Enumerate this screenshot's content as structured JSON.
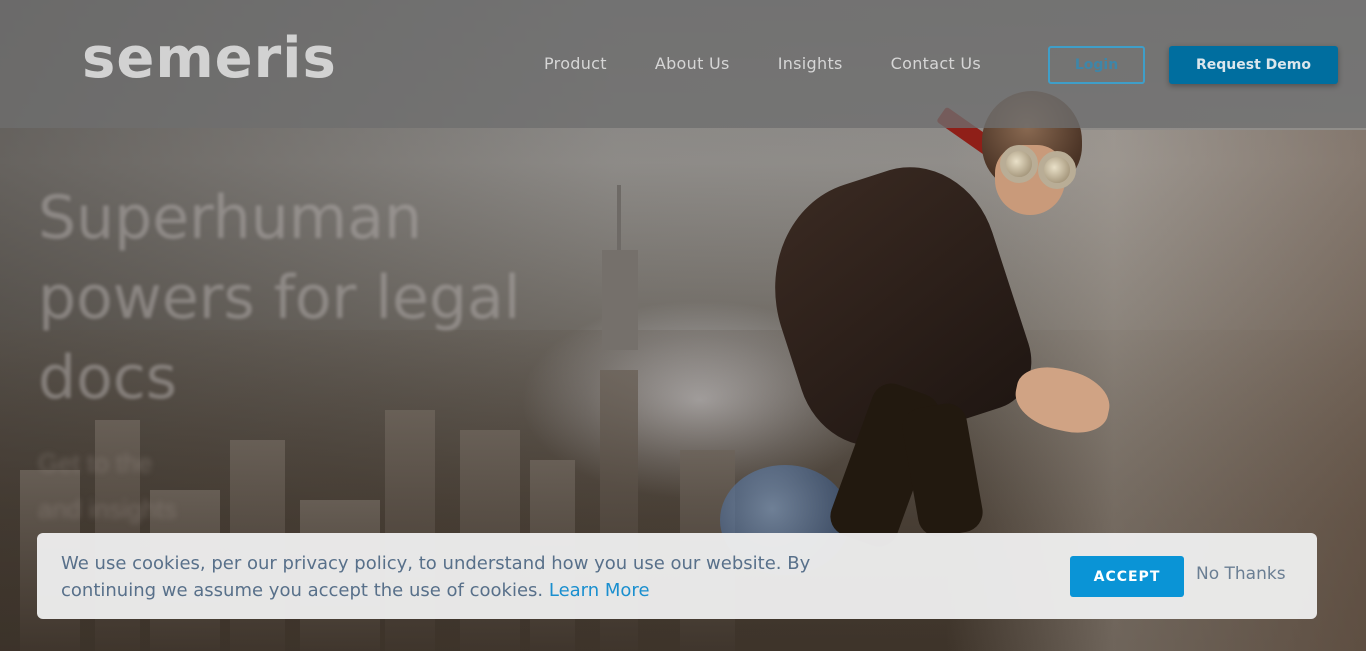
{
  "header": {
    "logo": "semeris",
    "nav": [
      "Product",
      "About Us",
      "Insights",
      "Contact Us"
    ],
    "login_label": "Login",
    "demo_label": "Request Demo"
  },
  "hero": {
    "title_lines": [
      "Superhuman",
      "powers for legal",
      "docs"
    ],
    "subtitle_lines": [
      "Get to the",
      "and insights"
    ]
  },
  "cookie": {
    "message": "We use cookies, per our privacy policy, to understand how you use our website. By continuing we assume you accept the use of cookies.",
    "learn_more": "Learn More",
    "accept_label": "ACCEPT",
    "decline_label": "No Thanks"
  },
  "colors": {
    "brand": "#006e9f",
    "accept": "#0a94d6",
    "link": "#1a8fcf"
  }
}
